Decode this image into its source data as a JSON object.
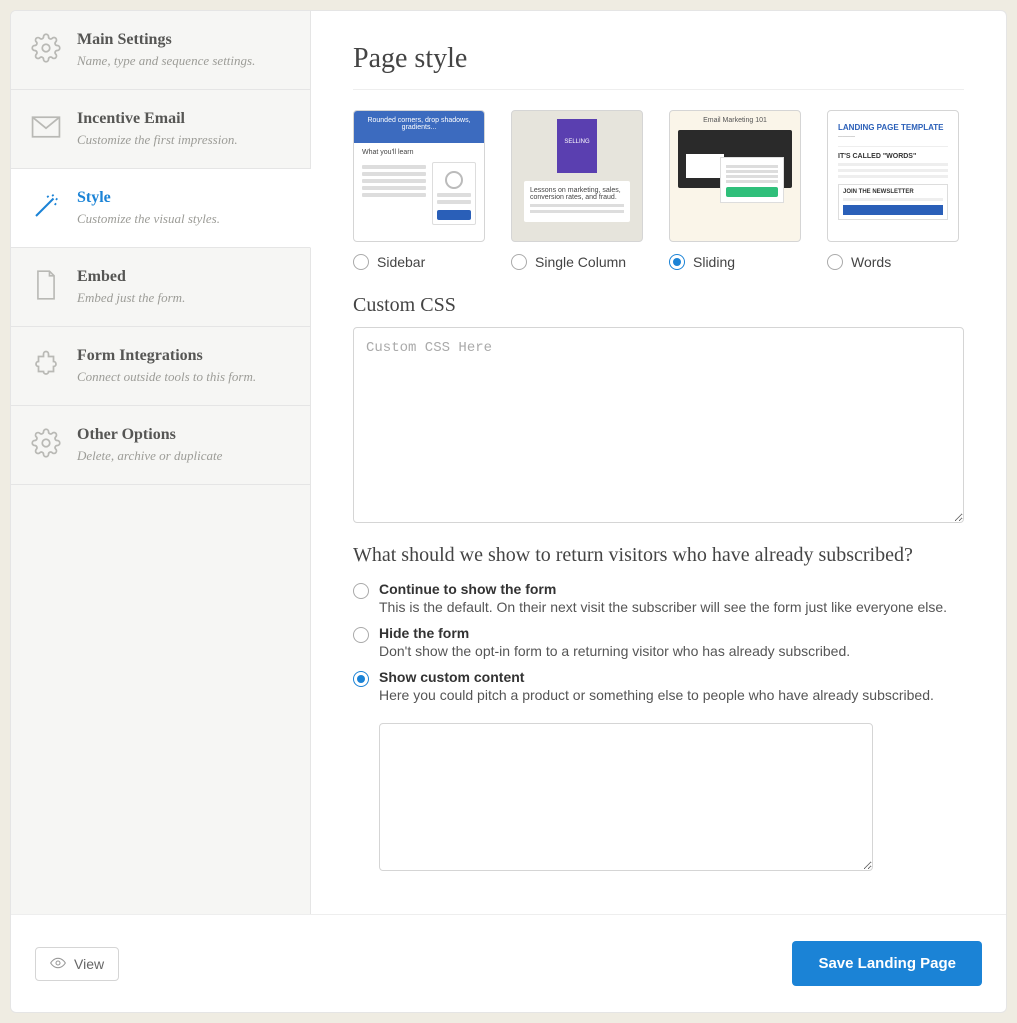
{
  "sidebar": {
    "items": [
      {
        "icon": "gear-icon",
        "title": "Main Settings",
        "sub": "Name, type and sequence settings."
      },
      {
        "icon": "envelope-icon",
        "title": "Incentive Email",
        "sub": "Customize the first impression."
      },
      {
        "icon": "wand-icon",
        "title": "Style",
        "sub": "Customize the visual styles."
      },
      {
        "icon": "page-icon",
        "title": "Embed",
        "sub": "Embed just the form."
      },
      {
        "icon": "puzzle-icon",
        "title": "Form Integrations",
        "sub": "Connect outside tools to this form."
      },
      {
        "icon": "gear-icon",
        "title": "Other Options",
        "sub": "Delete, archive or duplicate"
      }
    ],
    "active_index": 2
  },
  "page": {
    "title": "Page style",
    "styles": [
      {
        "key": "sidebar",
        "label": "Sidebar",
        "selected": false
      },
      {
        "key": "single",
        "label": "Single Column",
        "selected": false
      },
      {
        "key": "sliding",
        "label": "Sliding",
        "selected": true
      },
      {
        "key": "words",
        "label": "Words",
        "selected": false
      }
    ],
    "custom_css": {
      "heading": "Custom CSS",
      "placeholder": "Custom CSS Here",
      "value": ""
    },
    "return_visitors": {
      "question": "What should we show to return visitors who have already subscribed?",
      "options": [
        {
          "key": "continue",
          "title": "Continue to show the form",
          "desc": "This is the default. On their next visit the subscriber will see the form just like everyone else.",
          "selected": false
        },
        {
          "key": "hide",
          "title": "Hide the form",
          "desc": "Don't show the opt-in form to a returning visitor who has already subscribed.",
          "selected": false
        },
        {
          "key": "custom",
          "title": "Show custom content",
          "desc": "Here you could pitch a product or something else to people who have already subscribed.",
          "selected": true
        }
      ],
      "custom_content": ""
    }
  },
  "footer": {
    "view_label": "View",
    "save_label": "Save Landing Page"
  },
  "thumbnails": {
    "sidebar_banner": "Rounded corners, drop shadows, gradients...",
    "sidebar_heading": "What you'll learn",
    "single_book": "SELLING",
    "single_text": "Lessons on marketing, sales, conversion rates, and fraud.",
    "sliding_header": "Email Marketing 101",
    "words_title": "LANDING PAGE TEMPLATE",
    "words_called": "IT'S CALLED \"WORDS\"",
    "words_join": "JOIN THE NEWSLETTER"
  }
}
